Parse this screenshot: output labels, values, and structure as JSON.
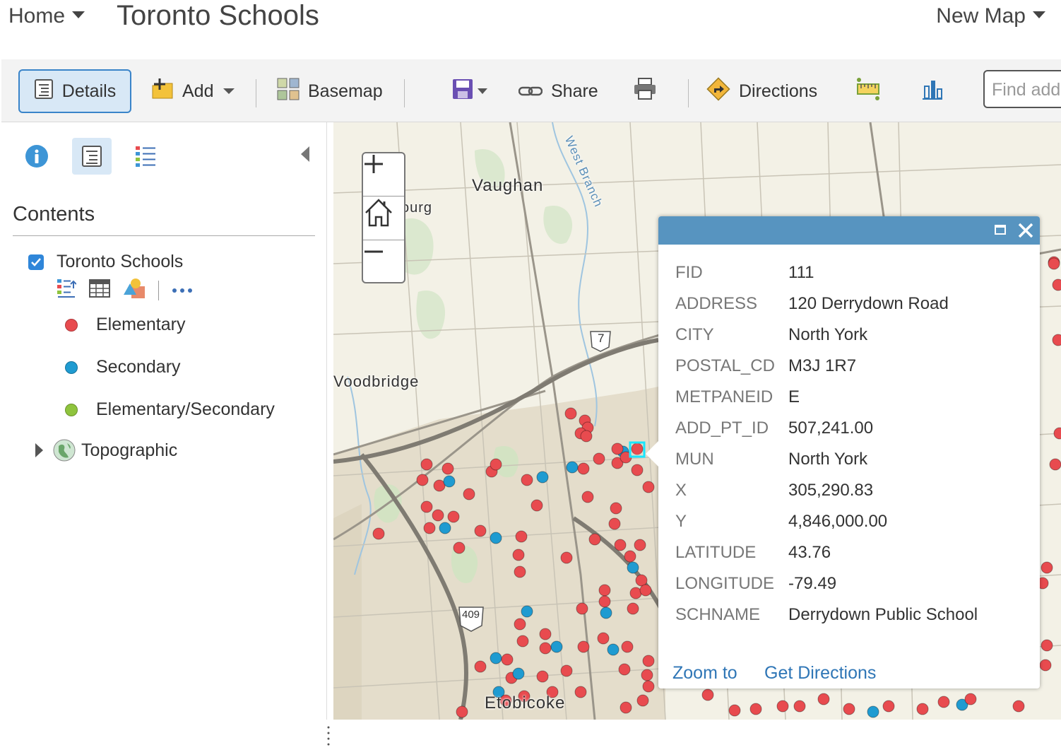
{
  "header": {
    "home_label": "Home",
    "map_title": "Toronto Schools",
    "new_map_label": "New Map"
  },
  "toolbar": {
    "details_label": "Details",
    "add_label": "Add",
    "basemap_label": "Basemap",
    "share_label": "Share",
    "directions_label": "Directions",
    "find_placeholder": "Find address or place",
    "find_visible": "Find add"
  },
  "sidebar": {
    "contents_heading": "Contents",
    "layer_name": "Toronto Schools",
    "legend": [
      {
        "label": "Elementary",
        "color": "#e84b4f"
      },
      {
        "label": "Secondary",
        "color": "#1f9bd1"
      },
      {
        "label": "Elementary/Secondary",
        "color": "#8fc43d"
      }
    ],
    "basemap_layer": "Topographic"
  },
  "map": {
    "labels": {
      "vaughan": "Vaughan",
      "woodbridge": "Woodbridge",
      "woodbridge_visible": "Voodbridge",
      "purg": "ourg",
      "etobicoke": "Etobicoke",
      "west_branch": "West Branch",
      "hwy7": "7",
      "hwy409": "409"
    }
  },
  "popup": {
    "attributes": [
      {
        "key": "FID",
        "value": "111"
      },
      {
        "key": "ADDRESS",
        "value": "120 Derrydown Road"
      },
      {
        "key": "CITY",
        "value": "North York"
      },
      {
        "key": "POSTAL_CD",
        "value": "M3J 1R7"
      },
      {
        "key": "METPANEID",
        "value": "E"
      },
      {
        "key": "ADD_PT_ID",
        "value": "507,241.00"
      },
      {
        "key": "MUN",
        "value": "North York"
      },
      {
        "key": "X",
        "value": "305,290.83"
      },
      {
        "key": "Y",
        "value": "4,846,000.00"
      },
      {
        "key": "LATITUDE",
        "value": "43.76"
      },
      {
        "key": "LONGITUDE",
        "value": "-79.49"
      },
      {
        "key": "SCHNAME",
        "value": "Derrydown Public School"
      }
    ],
    "zoom_to_label": "Zoom to",
    "get_directions_label": "Get Directions"
  },
  "colors": {
    "accent": "#3a84c9",
    "popup_header": "#5794c0",
    "elementary": "#e84b4f",
    "secondary": "#1f9bd1",
    "selection": "#19e6ff"
  }
}
